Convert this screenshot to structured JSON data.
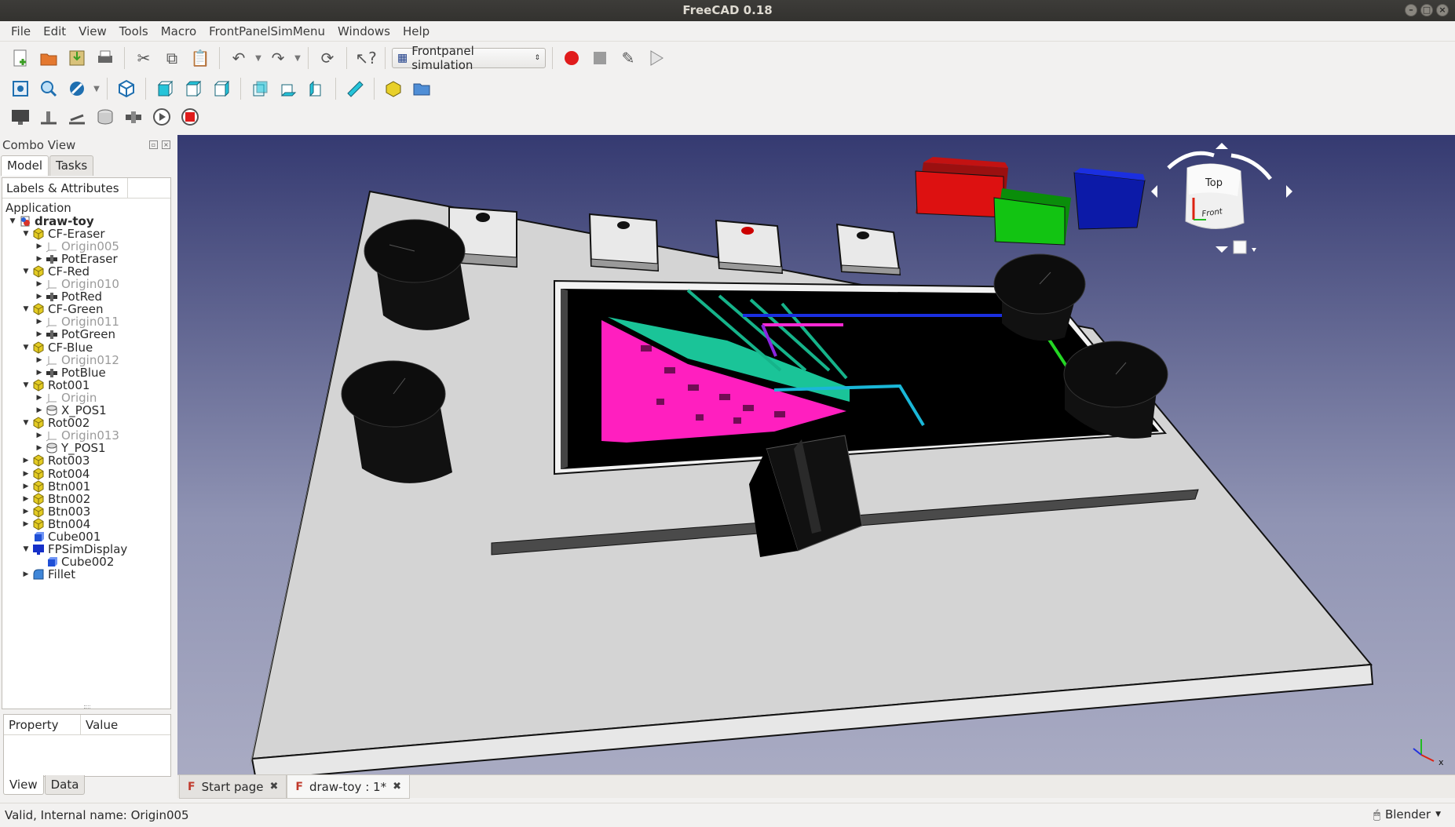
{
  "window": {
    "title": "FreeCAD 0.18"
  },
  "menu": [
    "File",
    "Edit",
    "View",
    "Tools",
    "Macro",
    "FrontPanelSimMenu",
    "Windows",
    "Help"
  ],
  "toolbar": {
    "workbench": "Frontpanel simulation"
  },
  "combo": {
    "title": "Combo View",
    "tabs": [
      "Model",
      "Tasks"
    ],
    "tree_header": "Labels & Attributes",
    "root": "Application"
  },
  "tree": [
    {
      "label": "draw-toy",
      "level": 0,
      "expanded": true,
      "icon": "document-icon",
      "bold": true
    },
    {
      "label": "CF-Eraser",
      "level": 1,
      "expanded": true,
      "icon": "part-icon"
    },
    {
      "label": "Origin005",
      "level": 2,
      "expanded": false,
      "icon": "origin-icon",
      "faded": true
    },
    {
      "label": "PotEraser",
      "level": 2,
      "expanded": false,
      "icon": "slider-icon"
    },
    {
      "label": "CF-Red",
      "level": 1,
      "expanded": true,
      "icon": "part-icon"
    },
    {
      "label": "Origin010",
      "level": 2,
      "expanded": false,
      "icon": "origin-icon",
      "faded": true
    },
    {
      "label": "PotRed",
      "level": 2,
      "expanded": false,
      "icon": "slider-icon"
    },
    {
      "label": "CF-Green",
      "level": 1,
      "expanded": true,
      "icon": "part-icon"
    },
    {
      "label": "Origin011",
      "level": 2,
      "expanded": false,
      "icon": "origin-icon",
      "faded": true
    },
    {
      "label": "PotGreen",
      "level": 2,
      "expanded": false,
      "icon": "slider-icon"
    },
    {
      "label": "CF-Blue",
      "level": 1,
      "expanded": true,
      "icon": "part-icon"
    },
    {
      "label": "Origin012",
      "level": 2,
      "expanded": false,
      "icon": "origin-icon",
      "faded": true
    },
    {
      "label": "PotBlue",
      "level": 2,
      "expanded": false,
      "icon": "slider-icon"
    },
    {
      "label": "Rot001",
      "level": 1,
      "expanded": true,
      "icon": "part-icon"
    },
    {
      "label": "Origin",
      "level": 2,
      "expanded": false,
      "icon": "origin-icon",
      "faded": true
    },
    {
      "label": "X_POS1",
      "level": 2,
      "expanded": false,
      "icon": "rotary-icon"
    },
    {
      "label": "Rot002",
      "level": 1,
      "expanded": true,
      "icon": "part-icon"
    },
    {
      "label": "Origin013",
      "level": 2,
      "expanded": false,
      "icon": "origin-icon",
      "faded": true
    },
    {
      "label": "Y_POS1",
      "level": 2,
      "expanded": false,
      "icon": "rotary-icon"
    },
    {
      "label": "Rot003",
      "level": 1,
      "expanded": false,
      "icon": "part-icon"
    },
    {
      "label": "Rot004",
      "level": 1,
      "expanded": false,
      "icon": "part-icon"
    },
    {
      "label": "Btn001",
      "level": 1,
      "expanded": false,
      "icon": "part-icon"
    },
    {
      "label": "Btn002",
      "level": 1,
      "expanded": false,
      "icon": "part-icon"
    },
    {
      "label": "Btn003",
      "level": 1,
      "expanded": false,
      "icon": "part-icon"
    },
    {
      "label": "Btn004",
      "level": 1,
      "expanded": false,
      "icon": "part-icon"
    },
    {
      "label": "Cube001",
      "level": 1,
      "expanded": null,
      "icon": "cube-icon"
    },
    {
      "label": "FPSimDisplay",
      "level": 1,
      "expanded": true,
      "icon": "display-icon"
    },
    {
      "label": "Cube002",
      "level": 2,
      "expanded": null,
      "icon": "cube-icon"
    },
    {
      "label": "Fillet",
      "level": 1,
      "expanded": false,
      "icon": "fillet-icon"
    }
  ],
  "property": {
    "col1": "Property",
    "col2": "Value",
    "tabs": [
      "View",
      "Data"
    ]
  },
  "viewport": {
    "navcube_top": "Top",
    "navcube_front": "Front",
    "axis_x": "x"
  },
  "doc_tabs": [
    {
      "label": "Start page",
      "active": false
    },
    {
      "label": "draw-toy : 1*",
      "active": true
    }
  ],
  "status": {
    "text": "Valid, Internal name: Origin005",
    "nav_style": "Blender"
  }
}
